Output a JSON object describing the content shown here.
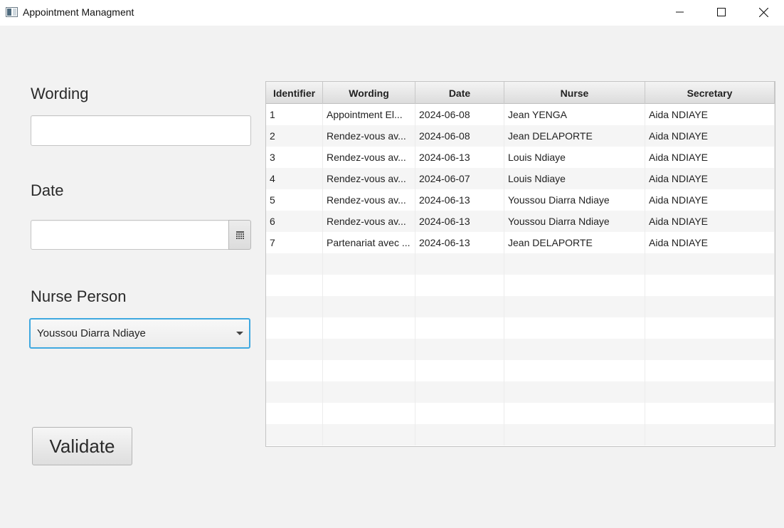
{
  "window": {
    "title": "Appointment Managment"
  },
  "form": {
    "wording_label": "Wording",
    "wording_value": "",
    "date_label": "Date",
    "date_value": "",
    "nurse_label": "Nurse Person",
    "nurse_selected": "Youssou Diarra Ndiaye",
    "validate_label": "Validate"
  },
  "table": {
    "columns": [
      "Identifier",
      "Wording",
      "Date",
      "Nurse",
      "Secretary"
    ],
    "rows": [
      [
        "1",
        "Appointment El...",
        "2024-06-08",
        "Jean YENGA",
        "Aida NDIAYE"
      ],
      [
        "2",
        "Rendez-vous av...",
        "2024-06-08",
        "Jean DELAPORTE",
        "Aida NDIAYE"
      ],
      [
        "3",
        "Rendez-vous av...",
        "2024-06-13",
        "Louis Ndiaye",
        "Aida NDIAYE"
      ],
      [
        "4",
        "Rendez-vous av...",
        "2024-06-07",
        "Louis Ndiaye",
        "Aida NDIAYE"
      ],
      [
        "5",
        "Rendez-vous av...",
        "2024-06-13",
        "Youssou Diarra Ndiaye",
        "Aida NDIAYE"
      ],
      [
        "6",
        "Rendez-vous av...",
        "2024-06-13",
        "Youssou Diarra Ndiaye",
        "Aida NDIAYE"
      ],
      [
        "7",
        "Partenariat avec ...",
        "2024-06-13",
        "Jean DELAPORTE",
        "Aida NDIAYE"
      ]
    ],
    "empty_rows": 9
  },
  "icons": {
    "app": "app-window-icon",
    "minimize": "minimize-icon",
    "maximize": "maximize-icon",
    "close": "close-icon",
    "calendar": "calendar-icon",
    "dropdown": "chevron-down-icon"
  },
  "colors": {
    "focus_border": "#3fa8e0",
    "background": "#f2f2f2"
  }
}
